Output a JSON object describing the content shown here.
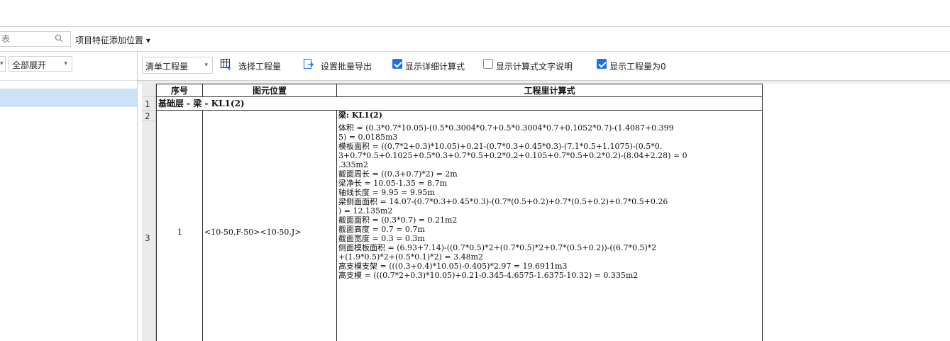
{
  "search": {
    "placeholder": "表"
  },
  "feature_position": "项目特征添加位置 ▾",
  "left_panel": {
    "expand_label": "全部展开",
    "arrow": "▾"
  },
  "toolbar": {
    "quantity_type": "清单工程量",
    "arrow": "▾",
    "select_quantity": "选择工程量",
    "batch_export": "设置批量导出",
    "show_detail_formula": {
      "label": "显示详细计算式",
      "checked": true
    },
    "show_formula_text": {
      "label": "显示计算式文字说明",
      "checked": false
    },
    "show_zero": {
      "label": "显示工程量为0",
      "checked": true
    }
  },
  "row_headers": [
    "1",
    "2",
    "3"
  ],
  "table": {
    "headers": {
      "seq": "序号",
      "position": "图元位置",
      "formula": "工程里计算式"
    },
    "group_title": "基础层 - 梁 - KL1(2)",
    "row": {
      "seq": "1",
      "position": "<10-50,F-50><10-50,J>"
    },
    "formula_lines": [
      "梁: KL1(2)",
      "体积 = (0.3*0.7*10.05)-(0.5*0.3004*0.7+0.5*0.3004*0.7+0.1052*0.7)-(1.4087+0.399",
      "5) = 0.0185m3",
      "模板面积 = ((0.7*2+0.3)*10.05)+0.21-(0.7*0.3+0.45*0.3)-(7.1*0.5+1.1075)-(0.5*0.",
      "3+0.7*0.5+0.1025+0.5*0.3+0.7*0.5+0.2*0.2+0.105+0.7*0.5+0.2*0.2)-(8.04+2.28) = 0",
      ".335m2",
      "截面周长 = ((0.3+0.7)*2) = 2m",
      "梁净长 = 10.05-1.35 = 8.7m",
      "轴线长度 = 9.95 = 9.95m",
      "梁侧面面积 = 14.07-(0.7*0.3+0.45*0.3)-(0.7*(0.5+0.2)+0.7*(0.5+0.2)+0.7*0.5+0.26",
      ") = 12.135m2",
      "截面面积 = (0.3*0.7) = 0.21m2",
      "截面高度 = 0.7 = 0.7m",
      "截面宽度 = 0.3 = 0.3m",
      "侧面模板面积 = (6.93+7.14)-((0.7*0.5)*2+(0.7*0.5)*2+0.7*(0.5+0.2))-((6.7*0.5)*2",
      "+(1.9*0.5)*2+(0.5*0.1)*2) = 3.48m2",
      "高支模支架 = (((0.3+0.4)*10.05)-0.405)*2.97 = 19.6911m3",
      "高支模 = (((0.7*2+0.3)*10.05)+0.21-0.345-4.6575-1.6375-10.32) = 0.335m2"
    ]
  },
  "colors": {
    "accent": "#1a73e8",
    "selected_row": "#cde2f7",
    "header_gray": "#eaeaea"
  }
}
